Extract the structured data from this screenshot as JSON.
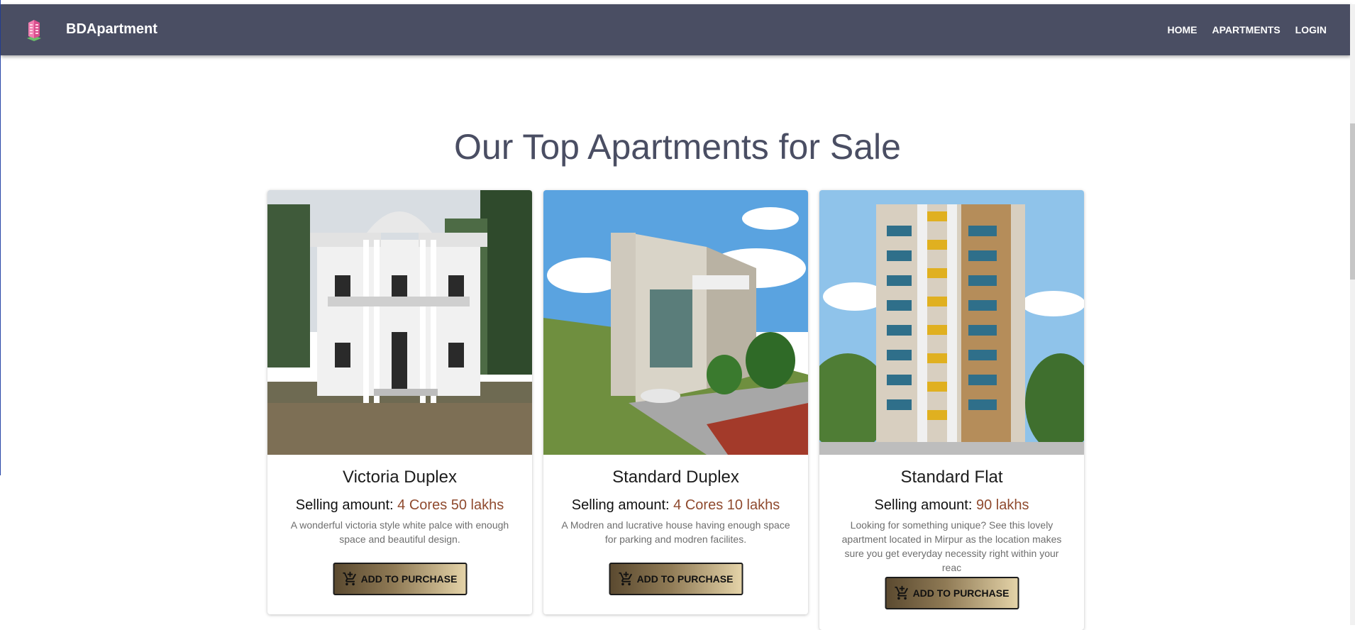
{
  "navbar": {
    "brand": "BDApartment",
    "links": [
      {
        "label": "HOME"
      },
      {
        "label": "APARTMENTS"
      },
      {
        "label": "LOGIN"
      }
    ]
  },
  "main": {
    "title": "Our Top Apartments for Sale",
    "cards": [
      {
        "title": "Victoria Duplex",
        "price_label": "Selling amount:",
        "price_value": "4 Cores 50 lakhs",
        "description": "A wonderful victoria style white palce with enough space and beautiful design.",
        "button_label": "ADD TO PURCHASE"
      },
      {
        "title": "Standard Duplex",
        "price_label": "Selling amount:",
        "price_value": "4 Cores 10 lakhs",
        "description": "A Modren and lucrative house having enough space for parking and modren facilites.",
        "button_label": "ADD TO PURCHASE"
      },
      {
        "title": "Standard Flat",
        "price_label": "Selling amount:",
        "price_value": "90 lakhs",
        "description": "Looking for something unique? See this lovely apartment located in Mirpur as the location makes sure you get everyday necessity right within your reac",
        "button_label": "ADD TO PURCHASE"
      }
    ]
  },
  "icons": {
    "logo": "building-logo-icon",
    "cart": "add-shopping-cart-icon"
  },
  "colors": {
    "navbar_bg": "#4a4e63",
    "title": "#4a4e63",
    "price_value": "#8f4a2e",
    "button_gradient_start": "#5b4a30",
    "button_gradient_end": "#e4d3a8"
  }
}
